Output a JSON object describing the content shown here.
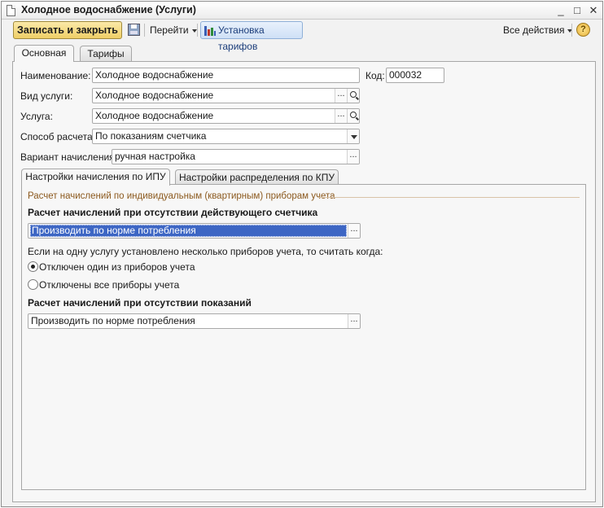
{
  "window": {
    "title": "Холодное водоснабжение (Услуги)",
    "controls": {
      "minimize": "_",
      "maximize": "□",
      "close": "✕"
    }
  },
  "toolbar": {
    "save_close_label": "Записать и закрыть",
    "goto_label": "Перейти",
    "tariffs_label": "Установка тарифов",
    "all_actions_label": "Все действия",
    "help_label": "?"
  },
  "tabs": [
    {
      "label": "Основная",
      "active": true
    },
    {
      "label": "Тарифы",
      "active": false
    }
  ],
  "form": {
    "name_label": "Наименование:",
    "name_value": "Холодное водоснабжение",
    "code_label": "Код:",
    "code_value": "000032",
    "service_type_label": "Вид услуги:",
    "service_type_value": "Холодное водоснабжение",
    "service_label": "Услуга:",
    "service_value": "Холодное водоснабжение",
    "calc_method_label": "Способ расчета:",
    "calc_method_value": "По показаниям счетчика",
    "accrual_variant_label": "Вариант начисления:",
    "accrual_variant_value": "ручная настройка",
    "select_btn": "...",
    "open_btn_icon": "magnifier-icon"
  },
  "inner_tabs": [
    {
      "label": "Настройки начисления по ИПУ",
      "active": true
    },
    {
      "label": "Настройки распределения по КПУ",
      "active": false
    }
  ],
  "ipu": {
    "group_title": "Расчет начислений по индивидуальным (квартирным) приборам учета",
    "no_meter_label": "Расчет начислений при отсутствии действующего счетчика",
    "no_meter_value": "Производить по норме потребления",
    "multi_meter_question": "Если на одну услугу установлено несколько приборов учета, то считать когда:",
    "radio_options": [
      {
        "label": "Отключен один из приборов учета",
        "checked": true
      },
      {
        "label": "Отключены все приборы учета",
        "checked": false
      }
    ],
    "no_readings_label": "Расчет начислений при отсутствии показаний",
    "no_readings_value": "Производить по норме потребления"
  },
  "colors": {
    "primary_button": "#efcf67",
    "selection": "#3d66c4",
    "group_title": "#8c5a1f"
  }
}
